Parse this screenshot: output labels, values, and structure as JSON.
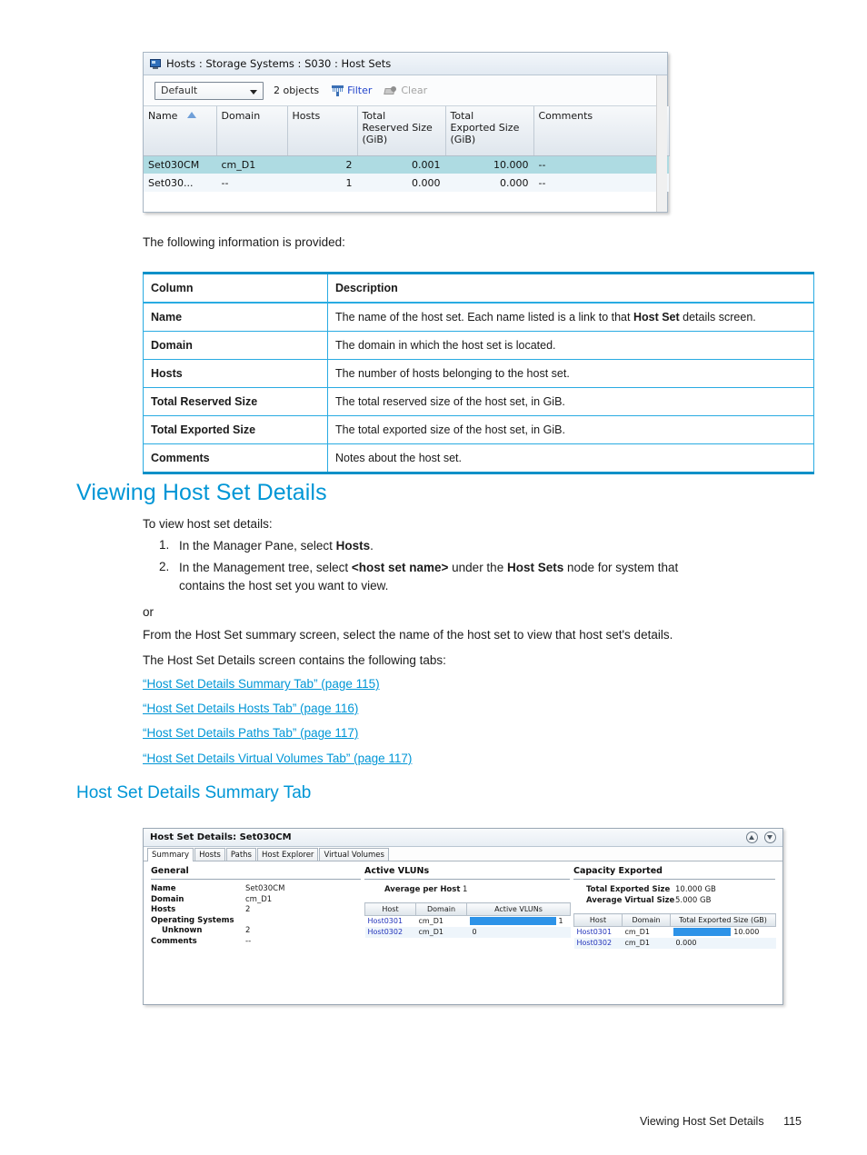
{
  "screenshot_hostsets": {
    "title": "Hosts : Storage Systems : S030 : Host Sets",
    "title_icon": "monitor-icon",
    "toolbar": {
      "view_selector_value": "Default",
      "object_count": "2 objects",
      "filter_label": "Filter",
      "filter_icon": "funnel-icon",
      "clear_label": "Clear",
      "clear_icon": "eraser-icon"
    },
    "columns": [
      "Name",
      "Domain",
      "Hosts",
      "Total Reserved Size (GiB)",
      "Total Exported Size (GiB)",
      "Comments"
    ],
    "column_lines": {
      "name": "Name",
      "domain": "Domain",
      "hosts": "Hosts",
      "reserved_l1": "Total",
      "reserved_l2": "Reserved Size",
      "reserved_l3": "(GiB)",
      "exported_l1": "Total",
      "exported_l2": "Exported Size",
      "exported_l3": "(GiB)",
      "comments": "Comments"
    },
    "sort_column": "Name",
    "sort_direction": "ascending",
    "rows": [
      {
        "name": "Set030CM",
        "domain": "cm_D1",
        "hosts": "2",
        "reserved": "0.001",
        "exported": "10.000",
        "comments": "--"
      },
      {
        "name": "Set030...",
        "domain": "--",
        "hosts": "1",
        "reserved": "0.000",
        "exported": "0.000",
        "comments": "--"
      }
    ]
  },
  "intro_text": "The following information is provided:",
  "desc_table": {
    "headers": [
      "Column",
      "Description"
    ],
    "rows": [
      {
        "column": "Name",
        "desc_pre": "The name of the host set. Each name listed is a link to that ",
        "desc_bold": "Host Set",
        "desc_post": " details screen."
      },
      {
        "column": "Domain",
        "desc_pre": "The domain in which the host set is located.",
        "desc_bold": "",
        "desc_post": ""
      },
      {
        "column": "Hosts",
        "desc_pre": "The number of hosts belonging to the host set.",
        "desc_bold": "",
        "desc_post": ""
      },
      {
        "column": "Total Reserved Size",
        "desc_pre": "The total reserved size of the host set, in GiB.",
        "desc_bold": "",
        "desc_post": ""
      },
      {
        "column": "Total Exported Size",
        "desc_pre": "The total exported size of the host set, in GiB.",
        "desc_bold": "",
        "desc_post": ""
      },
      {
        "column": "Comments",
        "desc_pre": "Notes about the host set.",
        "desc_bold": "",
        "desc_post": ""
      }
    ]
  },
  "section": {
    "heading": "Viewing Host Set Details",
    "lead": "To view host set details:",
    "step1_num": "1.",
    "step1_pre": "In the Manager Pane, select ",
    "step1_bold": "Hosts",
    "step1_post": ".",
    "step2_num": "2.",
    "step2_pre": "In the Management tree, select ",
    "step2_bold1": "<host set name>",
    "step2_mid": " under the ",
    "step2_bold2": "Host Sets",
    "step2_post": " node for system that",
    "step2_line2": "contains the host set you want to view.",
    "or": "or",
    "alt_path": "From the Host Set summary screen, select the name of the host set to view that host set's details.",
    "tabs_lead": "The Host Set Details screen contains the following tabs:",
    "links": [
      "“Host Set Details Summary Tab” (page 115)",
      "“Host Set Details Hosts Tab” (page 116)",
      "“Host Set Details Paths Tab” (page 117)",
      "“Host Set Details Virtual Volumes Tab” (page 117)"
    ],
    "subheading": "Host Set Details Summary Tab"
  },
  "screenshot_details": {
    "title": "Host Set Details: Set030CM",
    "window_buttons": [
      "collapse-up-icon",
      "collapse-down-icon"
    ],
    "tabs": [
      "Summary",
      "Hosts",
      "Paths",
      "Host Explorer",
      "Virtual Volumes"
    ],
    "active_tab": "Summary",
    "general": {
      "heading": "General",
      "fields": [
        {
          "label": "Name",
          "value": "Set030CM",
          "indent": false
        },
        {
          "label": "Domain",
          "value": "cm_D1",
          "indent": false
        },
        {
          "label": "Hosts",
          "value": "2",
          "indent": false
        },
        {
          "label": "Operating Systems",
          "value": "",
          "indent": false
        },
        {
          "label": "Unknown",
          "value": "2",
          "indent": true
        },
        {
          "label": "Comments",
          "value": "--",
          "indent": false
        }
      ]
    },
    "active_vluns": {
      "heading": "Active VLUNs",
      "summary_label": "Average per Host",
      "summary_value": "1",
      "columns": [
        "Host",
        "Domain",
        "Active VLUNs"
      ],
      "rows": [
        {
          "host": "Host0301",
          "domain": "cm_D1",
          "value": "1",
          "bar_pct": 88
        },
        {
          "host": "Host0302",
          "domain": "cm_D1",
          "value": "0",
          "bar_pct": 0
        }
      ]
    },
    "capacity_exported": {
      "heading": "Capacity Exported",
      "summary": [
        {
          "label": "Total Exported Size",
          "value": "10.000 GB"
        },
        {
          "label": "Average Virtual Size",
          "value": "5.000 GB"
        }
      ],
      "columns": [
        "Host",
        "Domain",
        "Total Exported Size (GB)"
      ],
      "rows": [
        {
          "host": "Host0301",
          "domain": "cm_D1",
          "value": "10.000",
          "bar_pct": 58
        },
        {
          "host": "Host0302",
          "domain": "cm_D1",
          "value": "0.000",
          "bar_pct": 0
        }
      ]
    }
  },
  "footer": {
    "chapter": "Viewing Host Set Details",
    "page_number": "115"
  },
  "colors": {
    "heading_blue": "#0096d6",
    "link_blue": "#0096d6",
    "table_border": "#29abe2",
    "bar_blue": "#2d93e8",
    "selected_row": "#aedbe2"
  }
}
